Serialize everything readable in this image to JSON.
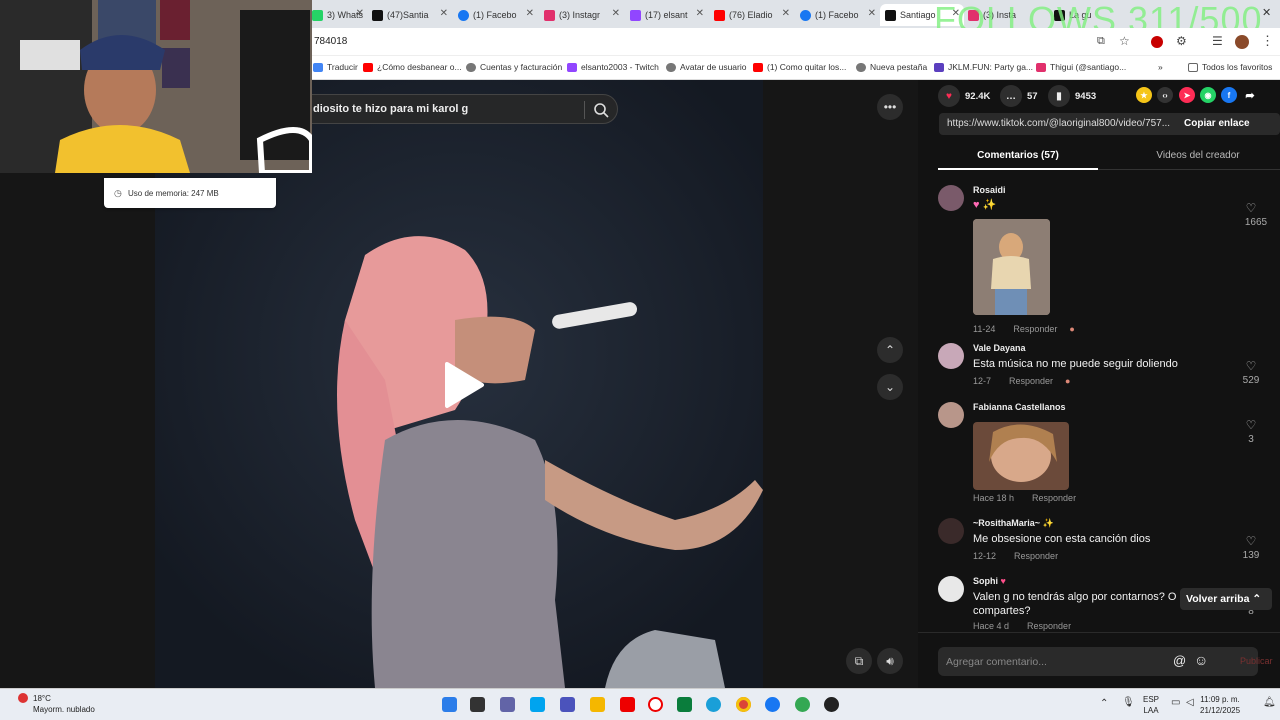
{
  "browser": {
    "tabs": [
      {
        "label": "3) Whats",
        "color": "#25d366"
      },
      {
        "label": "(47)Santia",
        "color": "#111111"
      },
      {
        "label": "(1) Facebo",
        "color": "#1877f2"
      },
      {
        "label": "(3) Instagr",
        "color": "#e1306c"
      },
      {
        "label": "(17) elsant",
        "color": "#9146ff"
      },
      {
        "label": "(76) Eladio",
        "color": "#ff0000"
      },
      {
        "label": "(1) Facebo",
        "color": "#1877f2"
      },
      {
        "label": "Santiago",
        "color": "#111111"
      },
      {
        "label": "(3) Insta",
        "color": "#e1306c"
      },
      {
        "label": "La gu",
        "color": "#111111"
      }
    ],
    "url": "784018",
    "bookmarks": [
      {
        "label": "Traducir"
      },
      {
        "label": "¿Cómo desbanear o..."
      },
      {
        "label": "Cuentas y facturación"
      },
      {
        "label": "elsanto2003 - Twitch"
      },
      {
        "label": "Avatar de usuario"
      },
      {
        "label": "(1) Como quitar los..."
      },
      {
        "label": "Nueva pestaña"
      },
      {
        "label": "JKLM.FUN: Party ga..."
      },
      {
        "label": "Thigui (@santiago..."
      },
      {
        "label": "Todos los favoritos"
      }
    ]
  },
  "overlay": {
    "follows": "FOLLOWS 311/500"
  },
  "memory_popup": {
    "text": "Uso de memoria: 247 MB"
  },
  "video": {
    "search_text": "diosito te hizo para mi karol g"
  },
  "stats": {
    "likes": "92.4K",
    "comments": "57",
    "saves": "9453"
  },
  "link": {
    "url": "https://www.tiktok.com/@laoriginal800/video/757...",
    "copy_label": "Copiar enlace"
  },
  "panel_tabs": {
    "comments": "Comentarios (57)",
    "creator_videos": "Videos del creador"
  },
  "comments": [
    {
      "name": "Rosaidi",
      "text": "",
      "date": "11-24",
      "reply": "Responder",
      "likes": "1665"
    },
    {
      "name": "Vale Dayana",
      "text": "Esta música no me puede seguir doliendo",
      "date": "12-7",
      "reply": "Responder",
      "likes": "529"
    },
    {
      "name": "Fabianna Castellanos",
      "text": "",
      "date": "Hace 18 h",
      "reply": "Responder",
      "likes": "3"
    },
    {
      "name": "~RosithaMaria~",
      "text": "Me obsesione con esta canción dios",
      "date": "12-12",
      "reply": "Responder",
      "likes": "139"
    },
    {
      "name": "Sophi",
      "text": "Valen g no tendrás algo por contarnos? O compartes?",
      "date": "Hace 4 d",
      "reply": "Responder",
      "likes": "8"
    }
  ],
  "back_to_top": "Volver arriba",
  "comment_input": {
    "placeholder": "Agregar comentario...",
    "publish": "Publicar"
  },
  "taskbar": {
    "temp": "18°C",
    "weather": "Mayorm. nublado",
    "lang1": "ESP",
    "lang2": "LAA",
    "time": "11:09 p. m.",
    "date": "21/12/2025"
  }
}
